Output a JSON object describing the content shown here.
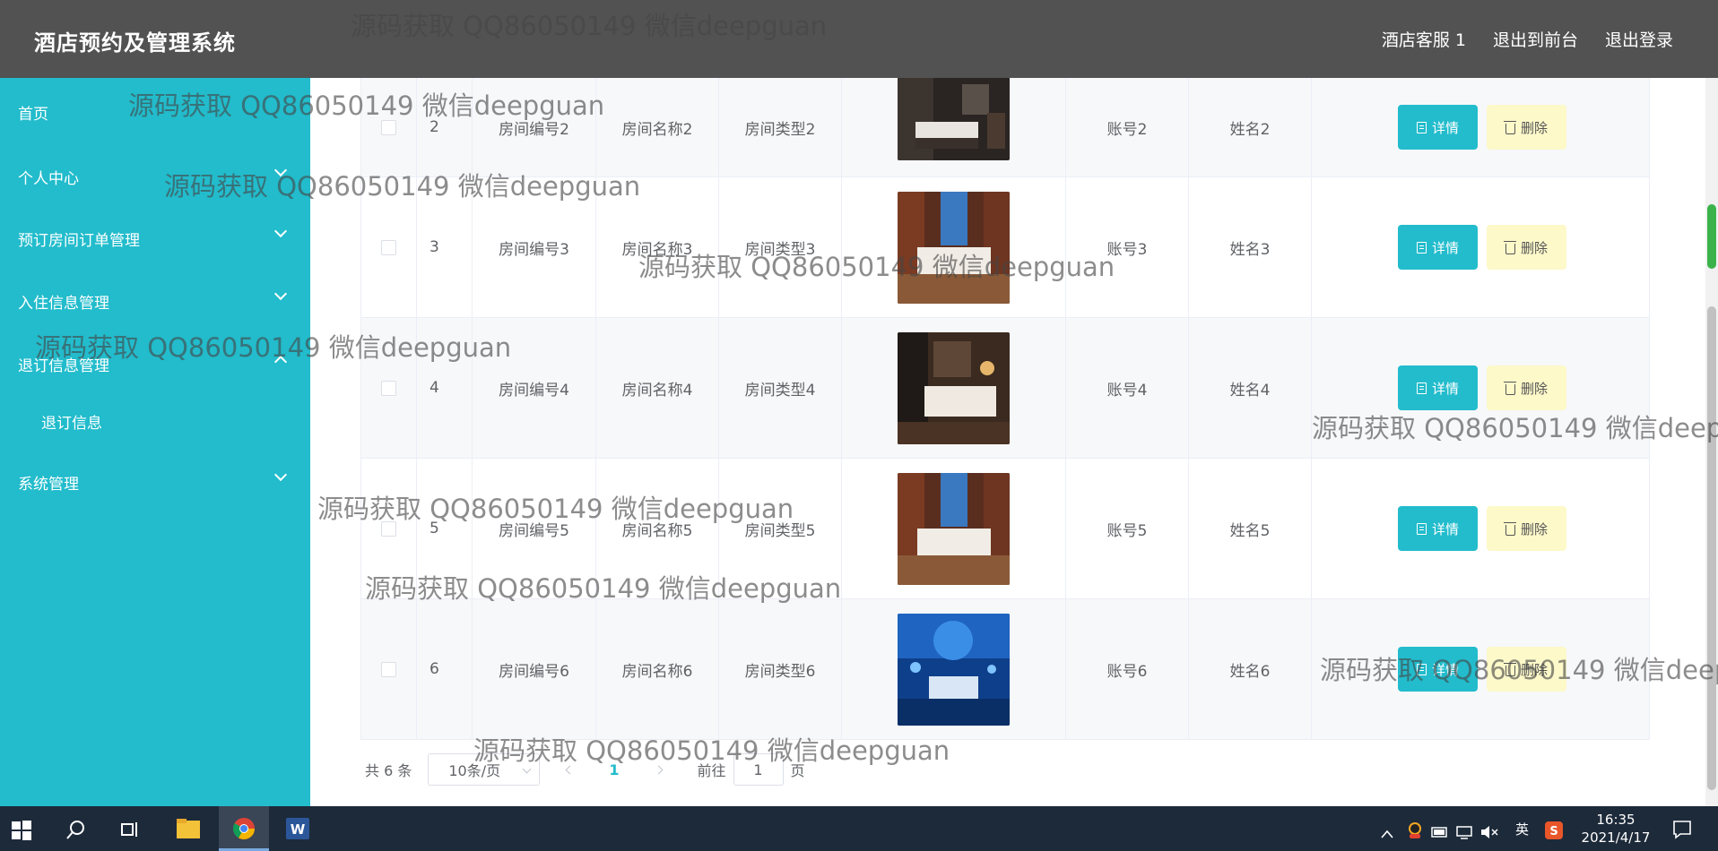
{
  "header": {
    "title": "酒店预约及管理系统",
    "nav": [
      "酒店客服 1",
      "退出到前台",
      "退出登录"
    ]
  },
  "sidebar": {
    "items": [
      {
        "label": "首页"
      },
      {
        "label": "个人中心"
      },
      {
        "label": "预订房间订单管理"
      },
      {
        "label": "入住信息管理"
      },
      {
        "label": "退订信息管理"
      },
      {
        "label": "系统管理"
      }
    ],
    "submenu": {
      "label": "退订信息"
    }
  },
  "table": {
    "rows": [
      {
        "index": "2",
        "room_no": "房间编号2",
        "room_name": "房间名称2",
        "room_type": "房间类型2",
        "account": "账号2",
        "name": "姓名2"
      },
      {
        "index": "3",
        "room_no": "房间编号3",
        "room_name": "房间名称3",
        "room_type": "房间类型3",
        "account": "账号3",
        "name": "姓名3"
      },
      {
        "index": "4",
        "room_no": "房间编号4",
        "room_name": "房间名称4",
        "room_type": "房间类型4",
        "account": "账号4",
        "name": "姓名4"
      },
      {
        "index": "5",
        "room_no": "房间编号5",
        "room_name": "房间名称5",
        "room_type": "房间类型5",
        "account": "账号5",
        "name": "姓名5"
      },
      {
        "index": "6",
        "room_no": "房间编号6",
        "room_name": "房间名称6",
        "room_type": "房间类型6",
        "account": "账号6",
        "name": "姓名6"
      }
    ],
    "detail_label": "详情",
    "delete_label": "删除"
  },
  "pager": {
    "total": "共 6 条",
    "page_size": "10条/页",
    "current": "1",
    "goto_label": "前往",
    "goto_value": "1",
    "page_unit": "页"
  },
  "watermark": "源码获取 QQ86050149 微信deepguan",
  "taskbar": {
    "ime": "英",
    "time": "16:35",
    "date": "2021/4/17"
  },
  "colors": {
    "accent": "#22bccc",
    "header_bg": "#525252",
    "delete_bg": "#fdf9c9"
  }
}
